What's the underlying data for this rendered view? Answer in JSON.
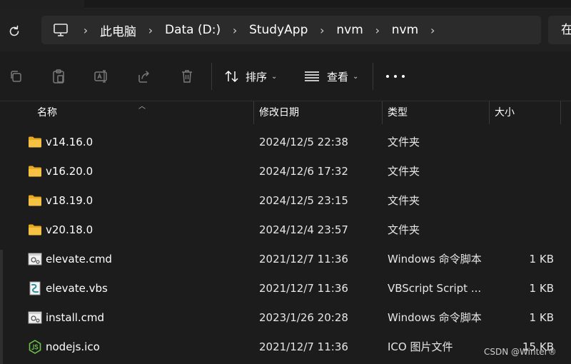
{
  "breadcrumb": {
    "items": [
      "此电脑",
      "Data (D:)",
      "StudyApp",
      "nvm",
      "nvm"
    ],
    "search_placeholder": "在"
  },
  "toolbar": {
    "sort_label": "排序",
    "view_label": "查看"
  },
  "columns": {
    "name": "名称",
    "modified": "修改日期",
    "type": "类型",
    "size": "大小"
  },
  "files": [
    {
      "name": "v14.16.0",
      "modified": "2024/12/5 22:38",
      "type": "文件夹",
      "size": "",
      "icon": "folder-icon"
    },
    {
      "name": "v16.20.0",
      "modified": "2024/12/6 17:32",
      "type": "文件夹",
      "size": "",
      "icon": "folder-icon"
    },
    {
      "name": "v18.19.0",
      "modified": "2024/12/5 23:15",
      "type": "文件夹",
      "size": "",
      "icon": "folder-icon"
    },
    {
      "name": "v20.18.0",
      "modified": "2024/12/4 23:57",
      "type": "文件夹",
      "size": "",
      "icon": "folder-icon"
    },
    {
      "name": "elevate.cmd",
      "modified": "2021/12/7 11:36",
      "type": "Windows 命令脚本",
      "size": "1 KB",
      "icon": "cmd-file-icon"
    },
    {
      "name": "elevate.vbs",
      "modified": "2021/12/7 11:36",
      "type": "VBScript Script ...",
      "size": "1 KB",
      "icon": "vbs-file-icon"
    },
    {
      "name": "install.cmd",
      "modified": "2023/1/26 20:28",
      "type": "Windows 命令脚本",
      "size": "1 KB",
      "icon": "cmd-file-icon"
    },
    {
      "name": "nodejs.ico",
      "modified": "2021/12/7 11:36",
      "type": "ICO 图片文件",
      "size": "15 KB",
      "icon": "nodejs-icon"
    }
  ],
  "watermark": "CSDN @Winter®",
  "colors": {
    "background": "#1c1c1c",
    "address_bar": "#2b2b2b",
    "folder": "#f6c244",
    "nodejs": "#6cc24a"
  }
}
